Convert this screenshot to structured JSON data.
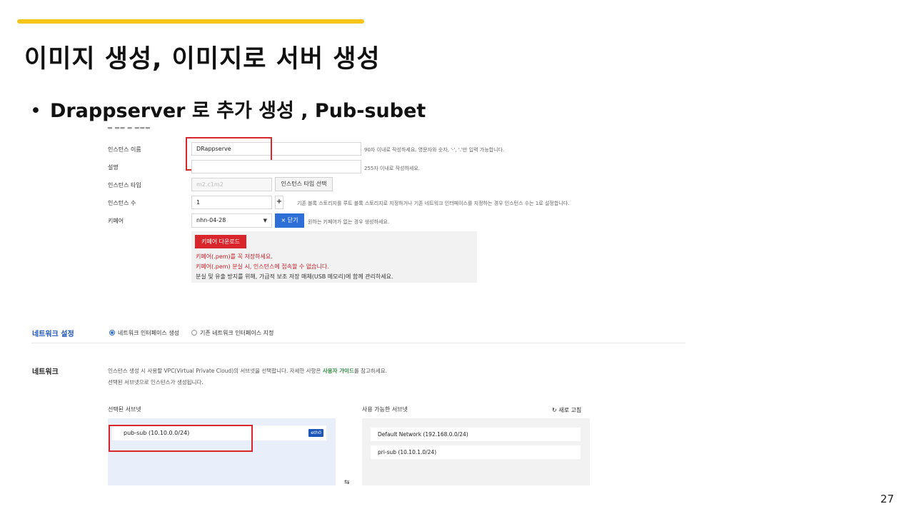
{
  "slide": {
    "title": "이미지 생성, 이미지로 서버 생성",
    "bullet": "Drappserver 로 추가 생성 , Pub-subet",
    "page_number": "27",
    "accent_color": "#f5c518"
  },
  "form": {
    "instance_name": {
      "label": "인스턴스 이름",
      "value": "DRappserve",
      "hint": "90자 이내로 작성하세요. 영문자와 숫자, '-', '.'만 입력 가능합니다."
    },
    "description": {
      "label": "설명",
      "value": "",
      "hint": "255자 이내로 작성하세요."
    },
    "instance_type": {
      "label": "인스턴스 타입",
      "value": "m2.c1m2",
      "button": "인스턴스 타입 선택"
    },
    "instance_count": {
      "label": "인스턴스 수",
      "value": "1",
      "plus": "+",
      "hint": "기존 블록 스토리지를 루트 블록 스토리지로 지정하거나 기존 네트워크 인터페이스를 지정하는 경우 인스턴스 수는 1로 설정합니다."
    },
    "keypair": {
      "label": "키페어",
      "selected": "nhn-04-28",
      "close_button": "× 닫기",
      "hint": "원하는 키페어가 없는 경우 생성하세요.",
      "download_button": "키페어 다운로드",
      "warning_1": "키페어(.pem)를 꼭 저장하세요.",
      "warning_2": "키페어(.pem) 분실 시, 인스턴스에 접속할 수 없습니다.",
      "note": "분실 및 유출 방지를 위해, 가급적 보조 저장 매체(USB 메모리)에 함께 관리하세요."
    }
  },
  "network_settings": {
    "label": "네트워크 설정",
    "option_create": "네트워크 인터페이스 생성",
    "option_existing": "기존 네트워크 인터페이스 지정",
    "selected_option": "create",
    "label_color": "#1e55b8"
  },
  "network": {
    "label": "네트워크",
    "desc_prefix": "인스턴스 생성 시 사용할 VPC(Virtual Private Cloud)의 서브넷을 선택합니다. 자세한 사항은 ",
    "desc_link": "사용자 가이드",
    "desc_suffix": "를 참고하세요.",
    "desc_line2": "선택된 서브넷으로 인스턴스가 생성됩니다.",
    "selected_header": "선택된 서브넷",
    "available_header": "사용 가능한 서브넷",
    "refresh": "새로 고침",
    "selected_subnets": [
      {
        "name": "pub-sub (10.10.0.0/24)",
        "badge": "eth0"
      }
    ],
    "available_subnets": [
      {
        "name": "Default Network (192.168.0.0/24)"
      },
      {
        "name": "pri-sub (10.10.1.0/24)"
      }
    ]
  }
}
